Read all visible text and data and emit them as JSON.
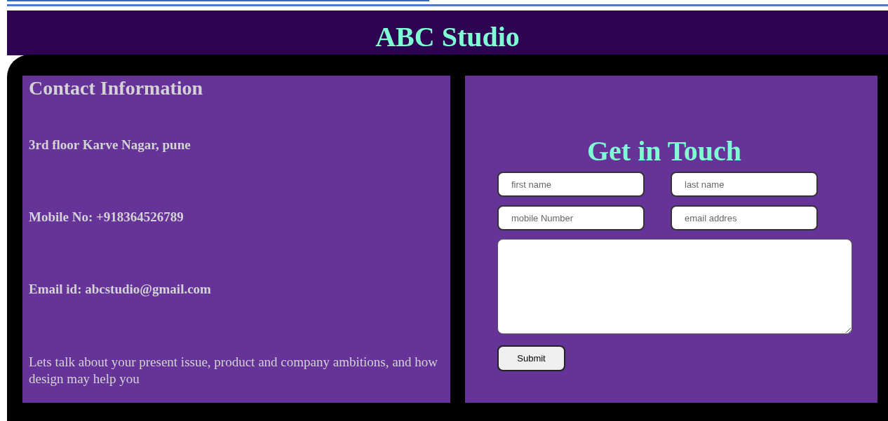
{
  "header": {
    "title": "ABC Studio"
  },
  "contact": {
    "heading": "Contact Information",
    "lines": [
      "3rd floor Karve Nagar, pune",
      "Mobile No: +918364526789",
      "Email id: abcstudio@gmail.com"
    ],
    "note": "Lets talk about your present issue, product and company ambitions, and how design may help you"
  },
  "form": {
    "heading": "Get in Touch",
    "fields": [
      {
        "placeholder": "first name"
      },
      {
        "placeholder": "last name"
      },
      {
        "placeholder": "mobile Number"
      },
      {
        "placeholder": "email addres"
      }
    ],
    "submit": "Submit"
  }
}
